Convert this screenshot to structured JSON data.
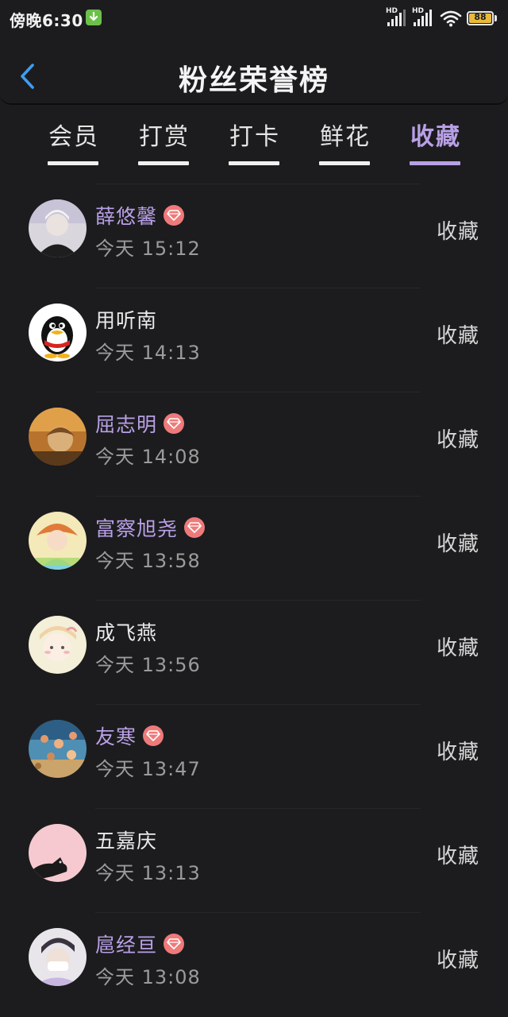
{
  "status_bar": {
    "time": "傍晚6:30",
    "signal_label_1": "HD",
    "signal_label_2": "HD",
    "battery": "88",
    "icons": [
      "download-icon",
      "signal-icon",
      "signal-icon",
      "wifi-icon",
      "battery-icon"
    ]
  },
  "header": {
    "title": "粉丝荣誉榜",
    "back_icon": "chevron-left-icon"
  },
  "tabs": [
    {
      "label": "会员",
      "active": false
    },
    {
      "label": "打赏",
      "active": false
    },
    {
      "label": "打卡",
      "active": false
    },
    {
      "label": "鲜花",
      "active": false
    },
    {
      "label": "收藏",
      "active": true
    }
  ],
  "colors": {
    "accent": "#b9a0e6",
    "background": "#1c1c1e",
    "vip_badge": "#ef7a7a"
  },
  "list": [
    {
      "name": "薛悠馨",
      "vip": true,
      "time": "今天 15:12",
      "action": "收藏"
    },
    {
      "name": "用听南",
      "vip": false,
      "time": "今天 14:13",
      "action": "收藏"
    },
    {
      "name": "屈志明",
      "vip": true,
      "time": "今天 14:08",
      "action": "收藏"
    },
    {
      "name": "富察旭尧",
      "vip": true,
      "time": "今天 13:58",
      "action": "收藏"
    },
    {
      "name": "成飞燕",
      "vip": false,
      "time": "今天 13:56",
      "action": "收藏"
    },
    {
      "name": "友寒",
      "vip": true,
      "time": "今天 13:47",
      "action": "收藏"
    },
    {
      "name": "五嘉庆",
      "vip": false,
      "time": "今天 13:13",
      "action": "收藏"
    },
    {
      "name": "扈经亘",
      "vip": true,
      "time": "今天 13:08",
      "action": "收藏"
    }
  ]
}
